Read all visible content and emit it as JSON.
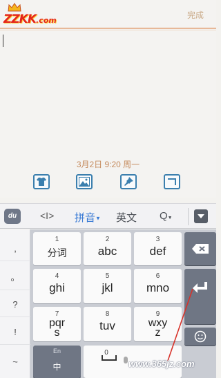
{
  "header": {
    "logo_text": "ZZKK",
    "logo_suffix": ".com",
    "done_label": "完成"
  },
  "note": {
    "date": "3月2日 9:20 周一",
    "tools": [
      {
        "icon": "shirt-icon"
      },
      {
        "icon": "image-icon"
      },
      {
        "icon": "pin-icon"
      },
      {
        "icon": "corner-arrow-icon"
      }
    ]
  },
  "ime_toolbar": {
    "logo": "du",
    "cursor_icon": "<I>",
    "pinyin_label": "拼音",
    "english_label": "英文",
    "search_icon": "Q",
    "hide_icon": "hide-keyboard-icon"
  },
  "symbols": [
    ",",
    "。",
    "?",
    "!",
    "~"
  ],
  "keys": [
    {
      "num": "1",
      "label": "分词"
    },
    {
      "num": "2",
      "label": "abc"
    },
    {
      "num": "3",
      "label": "def"
    },
    {
      "num": "4",
      "label": "ghi"
    },
    {
      "num": "5",
      "label": "jkl"
    },
    {
      "num": "6",
      "label": "mno"
    },
    {
      "num": "7",
      "label": "pqr\ns"
    },
    {
      "num": "8",
      "label": "tuv"
    },
    {
      "num": "9",
      "label": "wxy\nz"
    },
    {
      "num": "0",
      "label": ""
    }
  ],
  "bottom_keys": {
    "lang_small": "En",
    "lang_main": "中"
  },
  "watermark": "www.365jz.com",
  "colors": {
    "accent_blue": "#3a7bd5",
    "date_color": "#c58b5e",
    "done_color": "#c9a987",
    "dark_key": "#6f7684"
  }
}
